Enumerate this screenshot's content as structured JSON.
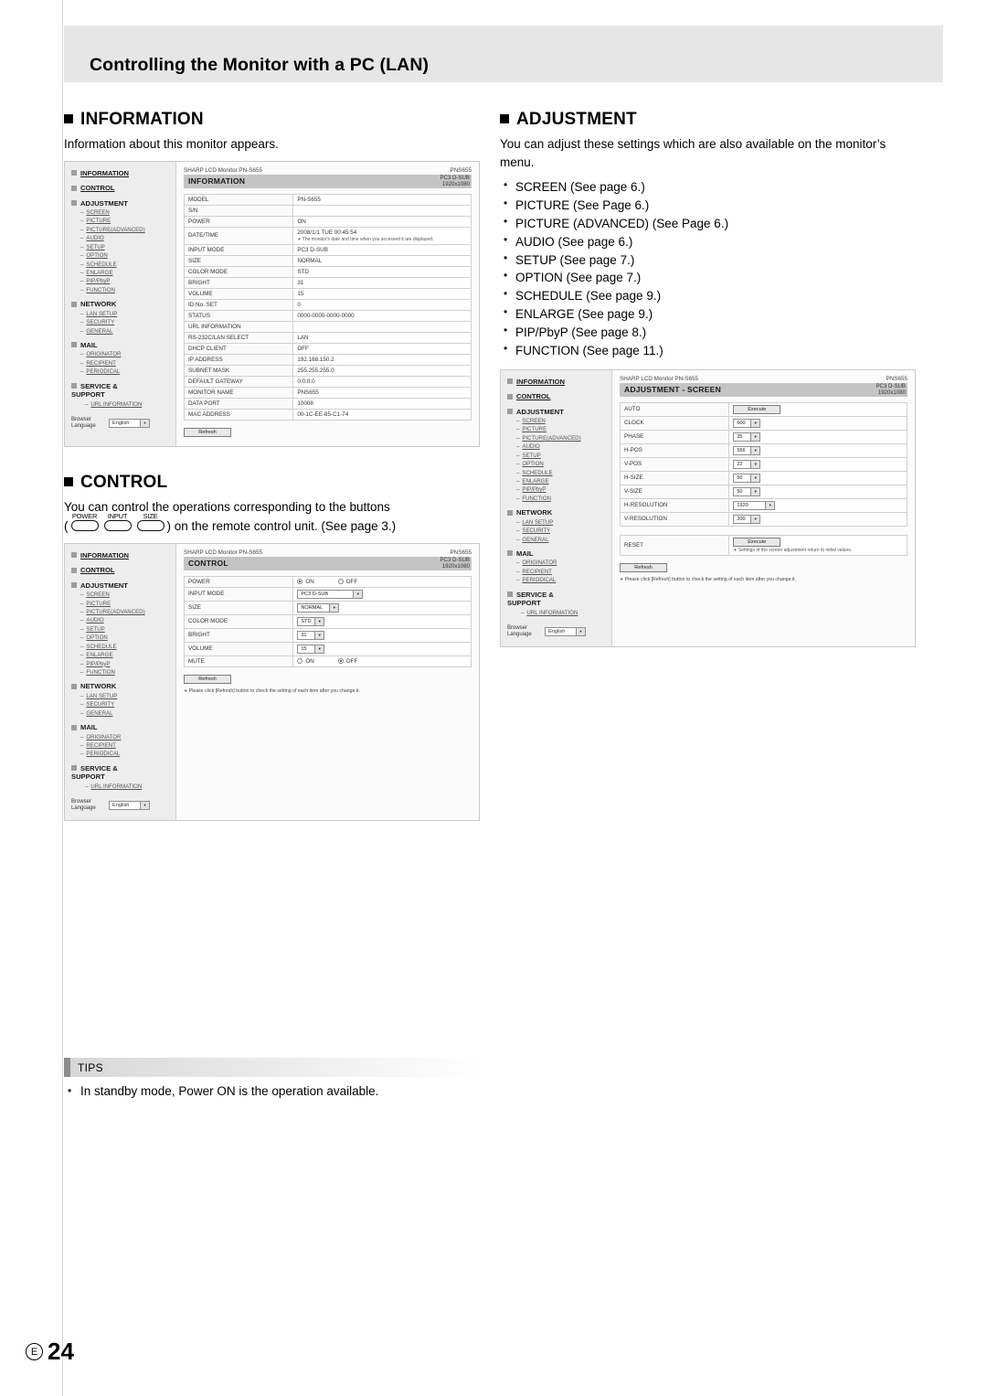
{
  "header": {
    "title": "Controlling the Monitor with a PC (LAN)"
  },
  "sections": {
    "information": {
      "heading": "INFORMATION",
      "body": "Information about this monitor appears."
    },
    "adjustment": {
      "heading": "ADJUSTMENT",
      "body": "You can adjust these settings which are also available on the monitor’s menu.",
      "items": [
        "SCREEN (See page 6.)",
        "PICTURE (See Page 6.)",
        "PICTURE (ADVANCED) (See Page 6.)",
        "AUDIO (See page 6.)",
        "SETUP (See page 7.)",
        "OPTION (See page 7.)",
        "SCHEDULE (See page 9.)",
        "ENLARGE (See page 9.)",
        "PIP/PbyP (See page 8.)",
        "FUNCTION (See page 11.)"
      ]
    },
    "control": {
      "heading": "CONTROL",
      "body_1": "You can control the operations corresponding to the buttons",
      "body_2a": "(",
      "body_2b": ") on the remote control unit. (See page 3.)",
      "remote_buttons": [
        "POWER",
        "INPUT",
        "SIZE"
      ]
    }
  },
  "nav": {
    "groups": [
      {
        "label": "INFORMATION",
        "items": []
      },
      {
        "label": "CONTROL",
        "items": []
      },
      {
        "label": "ADJUSTMENT",
        "items": [
          "SCREEN",
          "PICTURE",
          "PICTURE(ADVANCED)",
          "AUDIO",
          "SETUP",
          "OPTION",
          "SCHEDULE",
          "ENLARGE",
          "PIP/PbyP",
          "FUNCTION"
        ]
      },
      {
        "label": "NETWORK",
        "items": [
          "LAN SETUP",
          "SECURITY",
          "GENERAL"
        ]
      },
      {
        "label": "MAIL",
        "items": [
          "ORIGINATOR",
          "RECIPIENT",
          "PERIODICAL"
        ]
      },
      {
        "label": "SERVICE &",
        "label2": "SUPPORT",
        "items": [
          "URL INFORMATION"
        ]
      }
    ],
    "language": {
      "caption_1": "Browser",
      "caption_2": "Language",
      "value": "English"
    }
  },
  "shot_common": {
    "brand": "SHARP LCD Monitor PN-S655",
    "model_right": "PNS655",
    "input_right": "PC3 D-SUB",
    "res_right": "1920x1080",
    "refresh_label": "Refresh",
    "refresh_note": "∗ Please click [Refresh] button to check the setting of each item after you change it."
  },
  "shot_information": {
    "title": "INFORMATION",
    "rows": [
      {
        "k": "MODEL",
        "v": "PN-S655"
      },
      {
        "k": "S/N",
        "v": ""
      },
      {
        "k": "POWER",
        "v": "ON"
      },
      {
        "k": "DATE/TIME",
        "v": "2008/1/1 TUE 00:45:54",
        "note": "∗ The monitor's date and time when you accessed it are displayed."
      },
      {
        "k": "INPUT MODE",
        "v": "PC3 D-SUB"
      },
      {
        "k": "SIZE",
        "v": "NORMAL"
      },
      {
        "k": "COLOR MODE",
        "v": "STD"
      },
      {
        "k": "BRIGHT",
        "v": "31"
      },
      {
        "k": "VOLUME",
        "v": "15"
      },
      {
        "k": "ID No. SET",
        "v": "0"
      },
      {
        "k": "STATUS",
        "v": "0000-0000-0000-0000"
      },
      {
        "k": "URL INFORMATION",
        "v": ""
      },
      {
        "k": "RS-232C/LAN SELECT",
        "v": "LAN"
      },
      {
        "k": "DHCP CLIENT",
        "v": "OFF"
      },
      {
        "k": "IP ADDRESS",
        "v": "192.168.150.2"
      },
      {
        "k": "SUBNET MASK",
        "v": "255.255.255.0"
      },
      {
        "k": "DEFAULT GATEWAY",
        "v": "0.0.0.0"
      },
      {
        "k": "MONITOR NAME",
        "v": "PNS655"
      },
      {
        "k": "DATA PORT",
        "v": "10008"
      },
      {
        "k": "MAC ADDRESS",
        "v": "00-1C-EE-85-C1-74"
      }
    ]
  },
  "shot_control": {
    "title": "CONTROL",
    "rows": [
      {
        "k": "POWER",
        "type": "radio",
        "on_label": "ON",
        "off_label": "OFF",
        "selected": "ON"
      },
      {
        "k": "INPUT MODE",
        "type": "select",
        "v": "PC3 D-SUB",
        "w": "w-long"
      },
      {
        "k": "SIZE",
        "type": "select",
        "v": "NORMAL",
        "w": "w-mid"
      },
      {
        "k": "COLOR MODE",
        "type": "select",
        "v": "STD",
        "w": ""
      },
      {
        "k": "BRIGHT",
        "type": "select",
        "v": "31",
        "w": ""
      },
      {
        "k": "VOLUME",
        "type": "select",
        "v": "15",
        "w": ""
      },
      {
        "k": "MUTE",
        "type": "radio",
        "on_label": "ON",
        "off_label": "OFF",
        "selected": "OFF"
      }
    ]
  },
  "shot_adjustment": {
    "title": "ADJUSTMENT - SCREEN",
    "auto_label": "AUTO",
    "execute_label": "Execute",
    "rows": [
      {
        "k": "CLOCK",
        "v": "600"
      },
      {
        "k": "PHASE",
        "v": "35"
      },
      {
        "k": "H-POS",
        "v": "556"
      },
      {
        "k": "V-POS",
        "v": "22"
      },
      {
        "k": "H-SIZE",
        "v": "50"
      },
      {
        "k": "V-SIZE",
        "v": "50"
      },
      {
        "k": "H-RESOLUTION",
        "v": "1920"
      },
      {
        "k": "V-RESOLUTION",
        "v": "200"
      }
    ],
    "reset_label": "RESET",
    "reset_note": "∗ Settings of the screen adjustment return to initial values."
  },
  "tips": {
    "label": "TIPS",
    "text": "In standby mode, Power ON is the operation available."
  },
  "footer": {
    "mark": "E",
    "page": "24"
  },
  "colors": {
    "header_bg": "#e6e6e6",
    "titlebar_bg": "#c4c4c4",
    "nav_bg": "#ededed"
  }
}
